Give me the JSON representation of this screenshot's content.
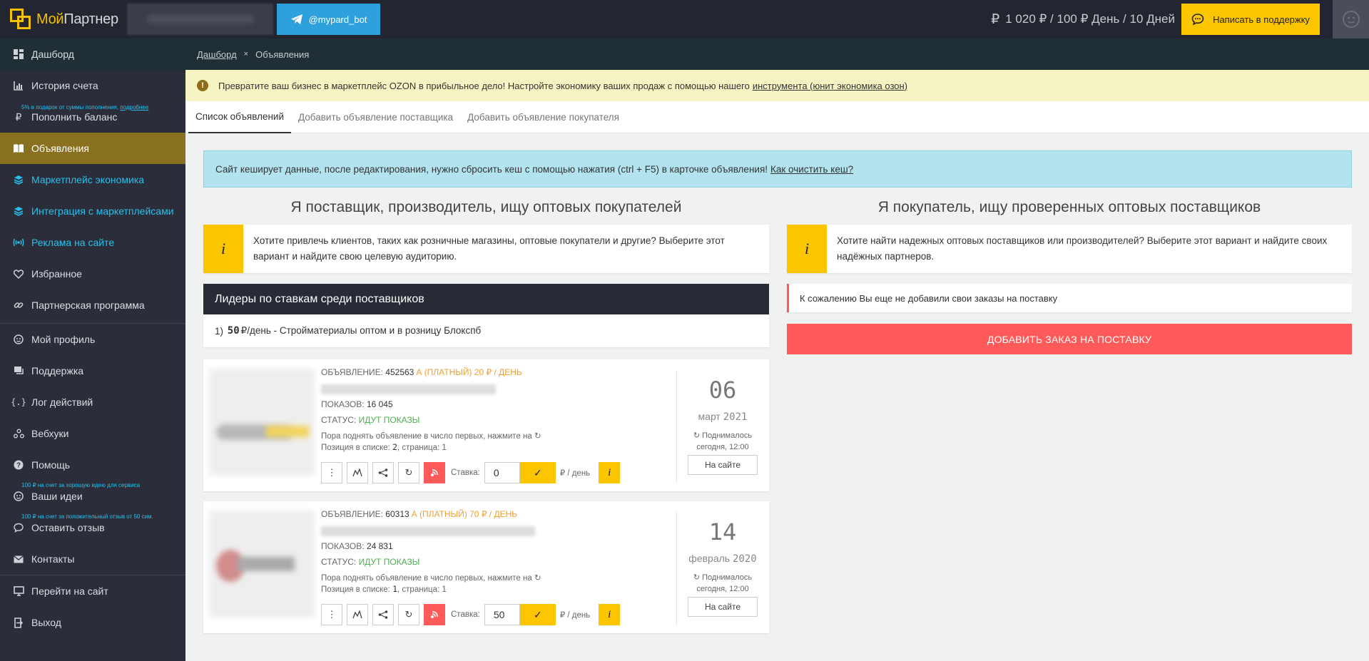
{
  "header": {
    "logo_part1": "Мой",
    "logo_part2": "Партнер",
    "telegram_label": "@mypard_bot",
    "balance": "1 020 ₽ / 100 ₽ День / 10 Дней",
    "support_label": "Написать в поддержку"
  },
  "sidebar": {
    "items": [
      {
        "label": "Дашборд",
        "icon": "dashboard-icon"
      },
      {
        "label": "История счета",
        "icon": "chart-icon"
      },
      {
        "label": "Пополнить баланс",
        "icon": "ruble-icon"
      },
      {
        "label": "Объявления",
        "icon": "book-icon"
      },
      {
        "label": "Маркетплейс экономика",
        "icon": "layers-icon"
      },
      {
        "label": "Интеграция с маркетплейсами",
        "icon": "layers-icon"
      },
      {
        "label": "Реклама на сайте",
        "icon": "broadcast-icon"
      },
      {
        "label": "Избранное",
        "icon": "heart-icon"
      },
      {
        "label": "Партнерская программа",
        "icon": "link-icon"
      },
      {
        "label": "Мой профиль",
        "icon": "profile-icon"
      },
      {
        "label": "Поддержка",
        "icon": "chat-icon"
      },
      {
        "label": "Лог действий",
        "icon": "code-icon"
      },
      {
        "label": "Вебхуки",
        "icon": "webhook-icon"
      },
      {
        "label": "Помощь",
        "icon": "help-icon"
      },
      {
        "label": "Ваши идеи",
        "icon": "idea-icon"
      },
      {
        "label": "Оставить отзыв",
        "icon": "comment-icon"
      },
      {
        "label": "Контакты",
        "icon": "mail-icon"
      },
      {
        "label": "Перейти на сайт",
        "icon": "monitor-icon"
      },
      {
        "label": "Выход",
        "icon": "exit-icon"
      }
    ],
    "hint_topup": "5% в подарок от суммы пополнения,",
    "hint_topup_link": "подробнее",
    "hint_ideas": "100 ₽ на счет за хорошую идею для сервиса",
    "hint_review": "100 ₽ на счет за положительный отзыв от 50 сим."
  },
  "breadcrumb": {
    "home": "Дашборд",
    "separator": "×",
    "current": "Объявления"
  },
  "warning": {
    "text": "Превратите ваш бизнес в маркетплейс OZON в прибыльное дело! Настройте экономику ваших продаж с помощью нашего",
    "link": "инструмента (юнит экономика озон)"
  },
  "tabs": [
    "Список объявлений",
    "Добавить объявление поставщика",
    "Добавить объявление покупателя"
  ],
  "cache_notice": {
    "text": "Сайт кеширует данные, после редактирования, нужно сбросить кеш с помощью нажатия (ctrl + F5) в карточке объявления!",
    "link": "Как очистить кеш?"
  },
  "supplier": {
    "title": "Я поставщик, производитель, ищу оптовых покупателей",
    "info_glyph": "i",
    "info_line1": "Хотите привлечь клиентов, таких как розничные магазины, оптовые покупатели и другие? Выберите этот",
    "info_line2": "вариант и найдите свою целевую аудиторию.",
    "leaders_title": "Лидеры по ставкам среди поставщиков",
    "leader_rank": "1)",
    "leader_amount": "50",
    "leader_rest": "₽/день - Стройматериалы оптом и в розницу Блокспб"
  },
  "buyer": {
    "title": "Я покупатель, ищу проверенных оптовых поставщиков",
    "info_glyph": "i",
    "info_line1": "Хотите найти надежных оптовых поставщиков или производителей? Выберите этот вариант и найдите своих",
    "info_line2": "надёжных партнеров.",
    "no_orders": "К сожалению Вы еще не добавили свои заказы на поставку",
    "add_order_label": "ДОБАВИТЬ ЗАКАЗ НА ПОСТАВКУ"
  },
  "listing_labels": {
    "ad": "ОБЪЯВЛЕНИЕ:",
    "views": "ПОКАЗОВ:",
    "status": "СТАТУС:",
    "raise_hint": "Пора поднять объявление в число первых, нажмите на",
    "position_prefix": "Позиция в списке:",
    "page_prefix": ", страница:",
    "bid_label": "Ставка:",
    "per_day": "₽ / день",
    "raised_line1": "Поднималось",
    "raised_line2": "сегодня, 12:00",
    "on_site": "На сайте",
    "info_glyph": "i",
    "ok_glyph": "✓"
  },
  "listings": [
    {
      "id": "452563",
      "type": "А (ПЛАТНЫЙ) 20 ₽ / ДЕНЬ",
      "views": "16 045",
      "status": "ИДУТ ПОКАЗЫ",
      "position": "2",
      "page": "1",
      "bid": "0",
      "day": "06",
      "month": "март",
      "year": "2021"
    },
    {
      "id": "60313",
      "type": "А (ПЛАТНЫЙ) 70 ₽ / ДЕНЬ",
      "views": "24 831",
      "status": "ИДУТ ПОКАЗЫ",
      "position": "1",
      "page": "1",
      "bid": "50",
      "day": "14",
      "month": "февраль",
      "year": "2020"
    }
  ],
  "colors": {
    "accent_yellow": "#fbc600",
    "sidebar_bg": "#2b2e3a",
    "active_item": "#8a7021",
    "cyan": "#27c0ec",
    "danger": "#ff5a5a",
    "telegram": "#2ea1dc",
    "status_green": "#4caf50",
    "paid_orange": "#f0a030"
  }
}
